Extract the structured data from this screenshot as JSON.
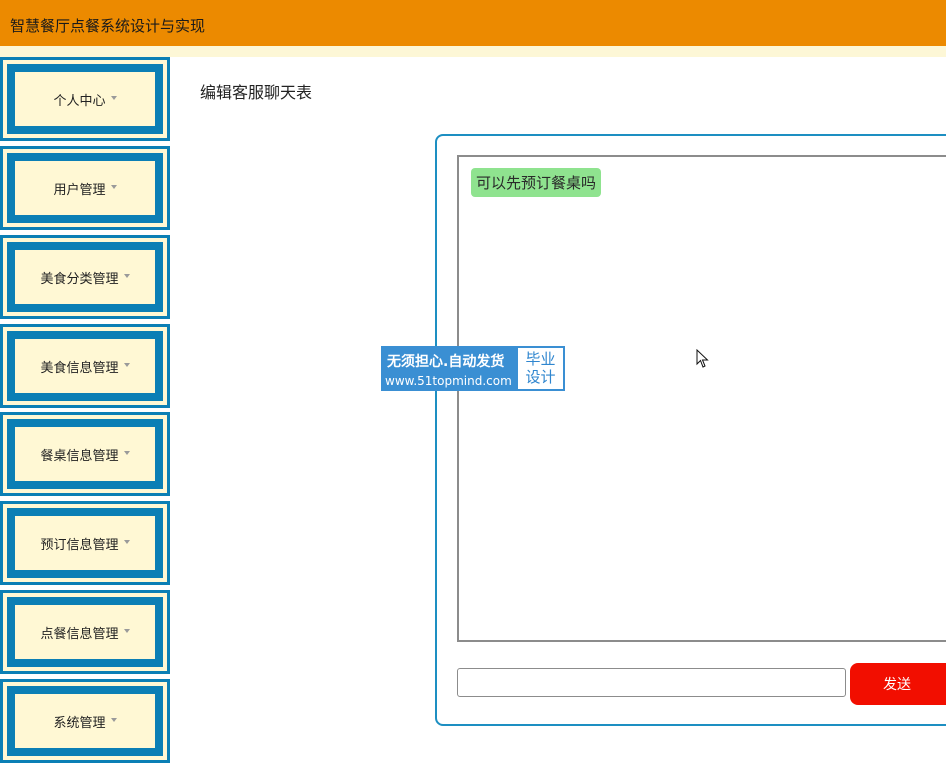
{
  "header": {
    "title": "智慧餐厅点餐系统设计与实现"
  },
  "sidebar": {
    "items": [
      {
        "label": "个人中心"
      },
      {
        "label": "用户管理"
      },
      {
        "label": "美食分类管理"
      },
      {
        "label": "美食信息管理"
      },
      {
        "label": "餐桌信息管理"
      },
      {
        "label": "预订信息管理"
      },
      {
        "label": "点餐信息管理"
      },
      {
        "label": "系统管理"
      }
    ]
  },
  "main": {
    "title": "编辑客服聊天表",
    "messages": [
      {
        "text": "可以先预订餐桌吗"
      }
    ],
    "input": {
      "value": "",
      "placeholder": ""
    },
    "send_label": "发送"
  },
  "watermark": {
    "line1": "无须担心.自动发货",
    "line2": "www.51topmind.com",
    "badge_line1": "毕业",
    "badge_line2": "设计"
  },
  "colors": {
    "header": "#ec8a00",
    "sidebar_border": "#0b7fb5",
    "sidebar_fill": "#fff8d4",
    "panel_border": "#1d8fc2",
    "bubble": "#8fe38f",
    "send_button": "#f20e00"
  }
}
